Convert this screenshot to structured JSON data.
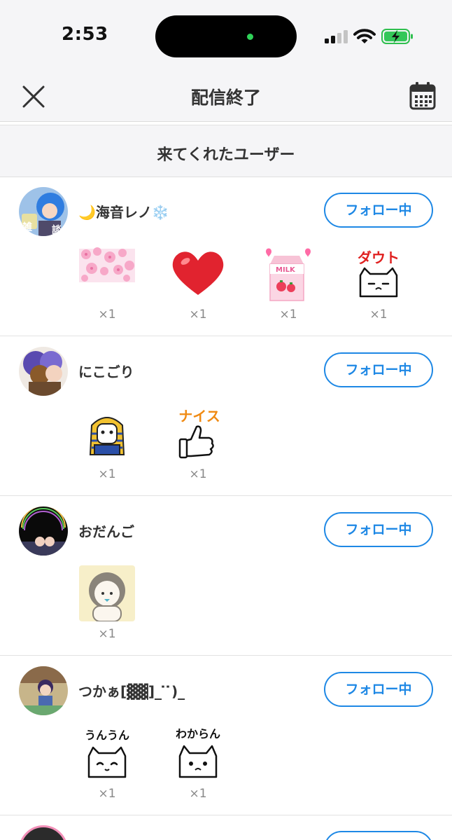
{
  "status_bar": {
    "time": "2:53"
  },
  "nav": {
    "title": "配信終了"
  },
  "section": {
    "title": "来てくれたユーザー"
  },
  "users": [
    {
      "name": "🌙海音レノ❄️",
      "follow_label": "フォロー中",
      "gifts": [
        {
          "icon": "cherry-blossom-gift",
          "count": "×1"
        },
        {
          "icon": "heart-gift",
          "count": "×1"
        },
        {
          "icon": "strawberry-milk-gift",
          "count": "×1"
        },
        {
          "icon": "cat-dauto-gift",
          "label": "ダウト",
          "count": "×1"
        }
      ]
    },
    {
      "name": "にこごり",
      "follow_label": "フォロー中",
      "gifts": [
        {
          "icon": "pharaoh-cat-gift",
          "count": "×1"
        },
        {
          "icon": "thumbs-up-nice-gift",
          "label": "ナイス",
          "count": "×1"
        }
      ]
    },
    {
      "name": "おだんご",
      "follow_label": "フォロー中",
      "gifts": [
        {
          "icon": "character-portrait-gift",
          "count": "×1"
        }
      ]
    },
    {
      "name": "つかぁ[▓▓]_ ̇ ̇)_",
      "follow_label": "フォロー中",
      "gifts": [
        {
          "icon": "cat-unun-gift",
          "label": "うんうん",
          "count": "×1"
        },
        {
          "icon": "cat-wakaran-gift",
          "label": "わからん",
          "count": "×1"
        }
      ]
    }
  ],
  "colors": {
    "accent": "#1e88e5",
    "background": "#f5f5f7"
  }
}
